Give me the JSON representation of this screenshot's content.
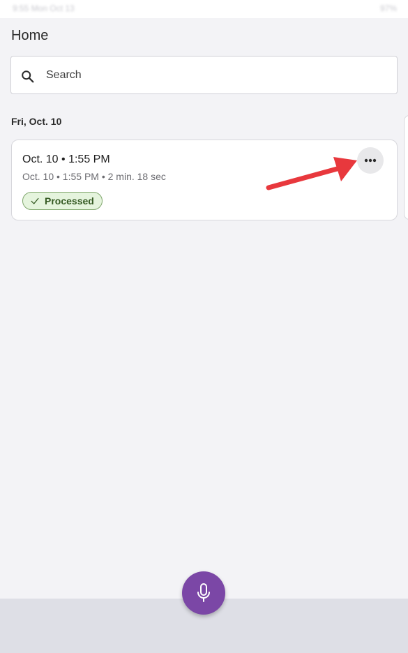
{
  "status_bar": {
    "left_text": "9:55 Mon Oct 13",
    "right_text": "97%"
  },
  "header": {
    "title": "Home"
  },
  "search": {
    "placeholder": "Search",
    "icon": "search-icon"
  },
  "groups": [
    {
      "date_label": "Fri, Oct. 10",
      "recordings": [
        {
          "title": "Oct. 10 • 1:55 PM",
          "subtitle": "Oct. 10 • 1:55 PM • 2 min. 18 sec",
          "status": "Processed",
          "status_icon": "check-icon",
          "menu_icon": "more-horizontal-icon"
        }
      ]
    }
  ],
  "fab": {
    "icon": "microphone-icon"
  },
  "colors": {
    "background": "#f3f3f6",
    "accent": "#7b47a6",
    "chip_bg": "#e5f4dd",
    "chip_text": "#355a23",
    "annotation_arrow": "#e8383d"
  }
}
